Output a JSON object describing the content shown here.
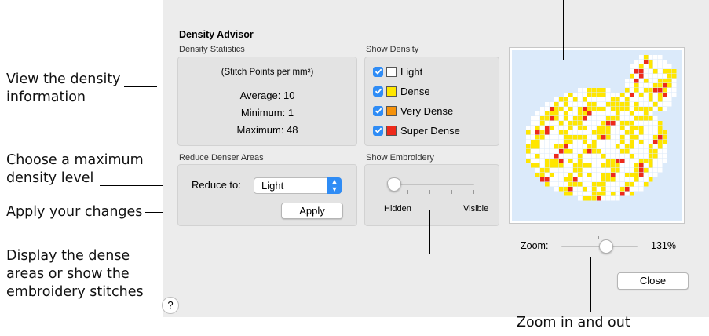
{
  "annotations": {
    "view_density": [
      "View the density",
      "information"
    ],
    "choose_max": [
      "Choose a maximum",
      "density level"
    ],
    "apply_changes": "Apply your changes",
    "display_dense": [
      "Display the dense",
      "areas or show the",
      "embroidery stitches"
    ],
    "zoom_in_out": "Zoom in and out"
  },
  "dialog": {
    "title": "Density Advisor",
    "stats": {
      "group_label": "Density Statistics",
      "units": "(Stitch Points per mm²)",
      "average": "Average: 10",
      "minimum": "Minimum: 1",
      "maximum": "Maximum: 48"
    },
    "show_density": {
      "group_label": "Show Density",
      "items": [
        {
          "label": "Light",
          "checked": true,
          "color": "#ffffff"
        },
        {
          "label": "Dense",
          "checked": true,
          "color": "#ffe600"
        },
        {
          "label": "Very Dense",
          "checked": true,
          "color": "#f5920a"
        },
        {
          "label": "Super Dense",
          "checked": true,
          "color": "#ee2a1b"
        }
      ]
    },
    "reduce": {
      "group_label": "Reduce Denser Areas",
      "reduce_label": "Reduce to:",
      "selected": "Light",
      "apply_label": "Apply"
    },
    "embroidery": {
      "group_label": "Show Embroidery",
      "hidden_label": "Hidden",
      "visible_label": "Visible",
      "level": 0
    },
    "zoom": {
      "label": "Zoom:",
      "value": "131%",
      "level": 0.55
    },
    "help_label": "?",
    "close_label": "Close",
    "preview_bg": "#dbeafa"
  }
}
